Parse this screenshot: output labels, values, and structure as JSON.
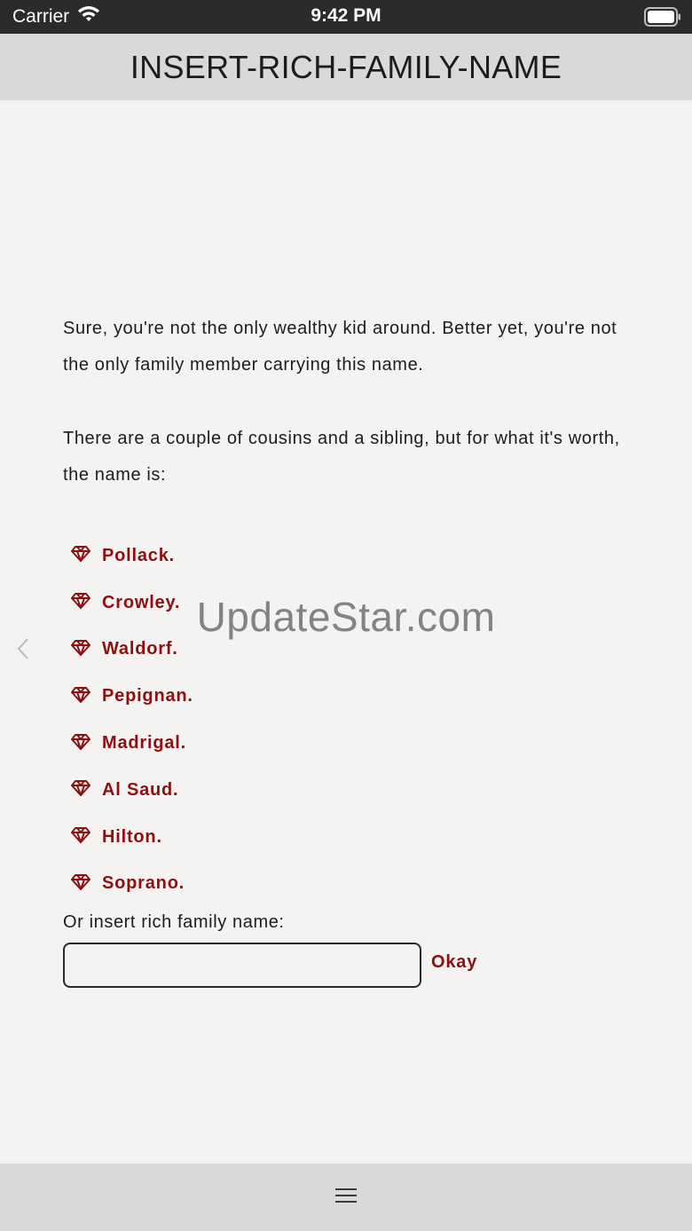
{
  "status_bar": {
    "carrier": "Carrier",
    "time": "9:42 PM"
  },
  "header": {
    "title": "INSERT-RICH-FAMILY-NAME"
  },
  "intro": {
    "paragraph1": "Sure, you're not the only wealthy kid around. Better yet, you're not the only family member carrying this name.",
    "paragraph2": "There are a couple of cousins and a sibling, but for what it's worth, the name is:"
  },
  "families": [
    {
      "label": "Pollack."
    },
    {
      "label": "Crowley."
    },
    {
      "label": "Waldorf."
    },
    {
      "label": "Pepignan."
    },
    {
      "label": "Madrigal."
    },
    {
      "label": "Al Saud."
    },
    {
      "label": "Hilton."
    },
    {
      "label": "Soprano."
    }
  ],
  "insert_form": {
    "label": "Or insert rich family name:",
    "value": "",
    "button_label": "Okay"
  },
  "watermark": "UpdateStar.com",
  "colors": {
    "accent": "#8e0f10",
    "background": "#f4f3f1",
    "bar": "#d9d9d9",
    "status_bar": "#2b2b2b"
  },
  "icons": {
    "list_bullet": "gem-icon",
    "bottom": "menu-icon",
    "side": "chevron-left-icon"
  }
}
